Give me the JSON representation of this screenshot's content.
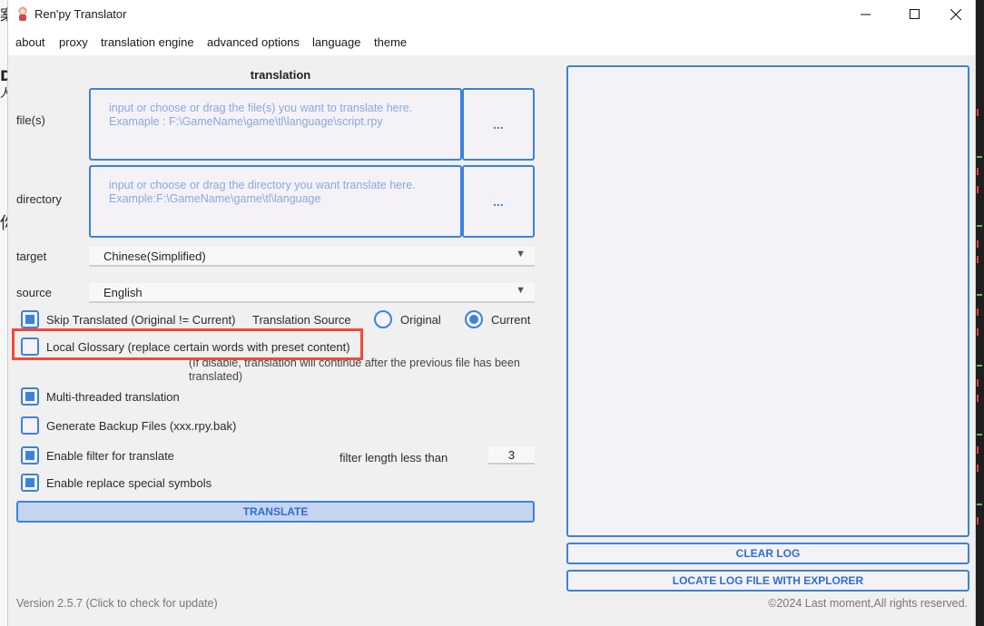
{
  "window": {
    "title": "Ren'py Translator"
  },
  "menu": [
    "about",
    "proxy",
    "translation engine",
    "advanced options",
    "language",
    "theme"
  ],
  "section_title": "translation",
  "files": {
    "label": "file(s)",
    "placeholder_line1": "input or choose or drag the file(s) you want to translate here.",
    "placeholder_line2": "Examaple : F:\\GameName\\game\\tl\\language\\script.rpy",
    "browse_label": "..."
  },
  "directory": {
    "label": "directory",
    "placeholder_line1": "input or choose or drag the directory you want translate here.",
    "placeholder_line2": "Example:F:\\GameName\\game\\tl\\language",
    "browse_label": "..."
  },
  "target": {
    "label": "target",
    "value": "Chinese(Simplified)"
  },
  "source": {
    "label": "source",
    "value": "English"
  },
  "options": {
    "skip_translated": {
      "label": "Skip Translated (Original != Current)",
      "checked": true
    },
    "translation_source": {
      "label": "Translation Source",
      "original": "Original",
      "current": "Current",
      "selected": "Current"
    },
    "local_glossary": {
      "label": "Local Glossary (replace certain words with preset content)",
      "checked": false
    },
    "note": "(If disable, translation will continue after the previous file has been translated)",
    "multithreaded": {
      "label": "Multi-threaded translation",
      "checked": true
    },
    "backup": {
      "label": "Generate Backup Files (xxx.rpy.bak)",
      "checked": false
    },
    "filter": {
      "label": "Enable filter for translate",
      "checked": true,
      "length_label": "filter length less than",
      "length_value": "3"
    },
    "replace_symbols": {
      "label": "Enable replace special symbols",
      "checked": true
    }
  },
  "buttons": {
    "translate": "TRANSLATE",
    "clear_log": "CLEAR LOG",
    "locate_log": "LOCATE LOG FILE WITH EXPLORER"
  },
  "footer": {
    "version": "Version 2.5.7 (Click to check for update)",
    "copyright": "©2024 Last moment,All rights reserved."
  },
  "colors": {
    "accent": "#3b82e0",
    "highlight": "#f04a3a",
    "button_fill": "#c5d4ef"
  }
}
